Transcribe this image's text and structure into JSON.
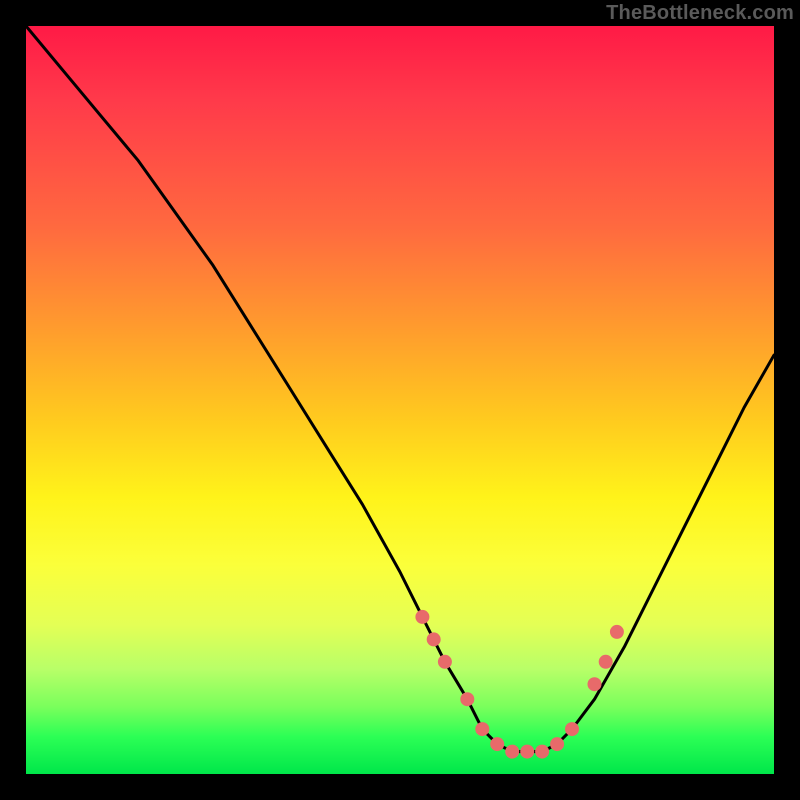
{
  "watermark": "TheBottleneck.com",
  "chart_data": {
    "type": "line",
    "title": "",
    "xlabel": "",
    "ylabel": "",
    "xlim": [
      0,
      100
    ],
    "ylim": [
      0,
      100
    ],
    "curve": {
      "name": "bottleneck-curve",
      "x": [
        0,
        5,
        10,
        15,
        20,
        25,
        30,
        35,
        40,
        45,
        50,
        53,
        56,
        59,
        61,
        63,
        65,
        67,
        69,
        71,
        73,
        76,
        80,
        84,
        88,
        92,
        96,
        100
      ],
      "y": [
        100,
        94,
        88,
        82,
        75,
        68,
        60,
        52,
        44,
        36,
        27,
        21,
        15,
        10,
        6,
        4,
        3,
        3,
        3,
        4,
        6,
        10,
        17,
        25,
        33,
        41,
        49,
        56
      ]
    },
    "markers": {
      "name": "highlight-points",
      "color": "#e86a6a",
      "radius_px": 7,
      "x": [
        53,
        54.5,
        56,
        59,
        61,
        63,
        65,
        67,
        69,
        71,
        73,
        76,
        77.5,
        79
      ],
      "y": [
        21,
        18,
        15,
        10,
        6,
        4,
        3,
        3,
        3,
        4,
        6,
        12,
        15,
        19
      ]
    },
    "gradient_note": "Background encodes y via color: red=high, green=low"
  }
}
